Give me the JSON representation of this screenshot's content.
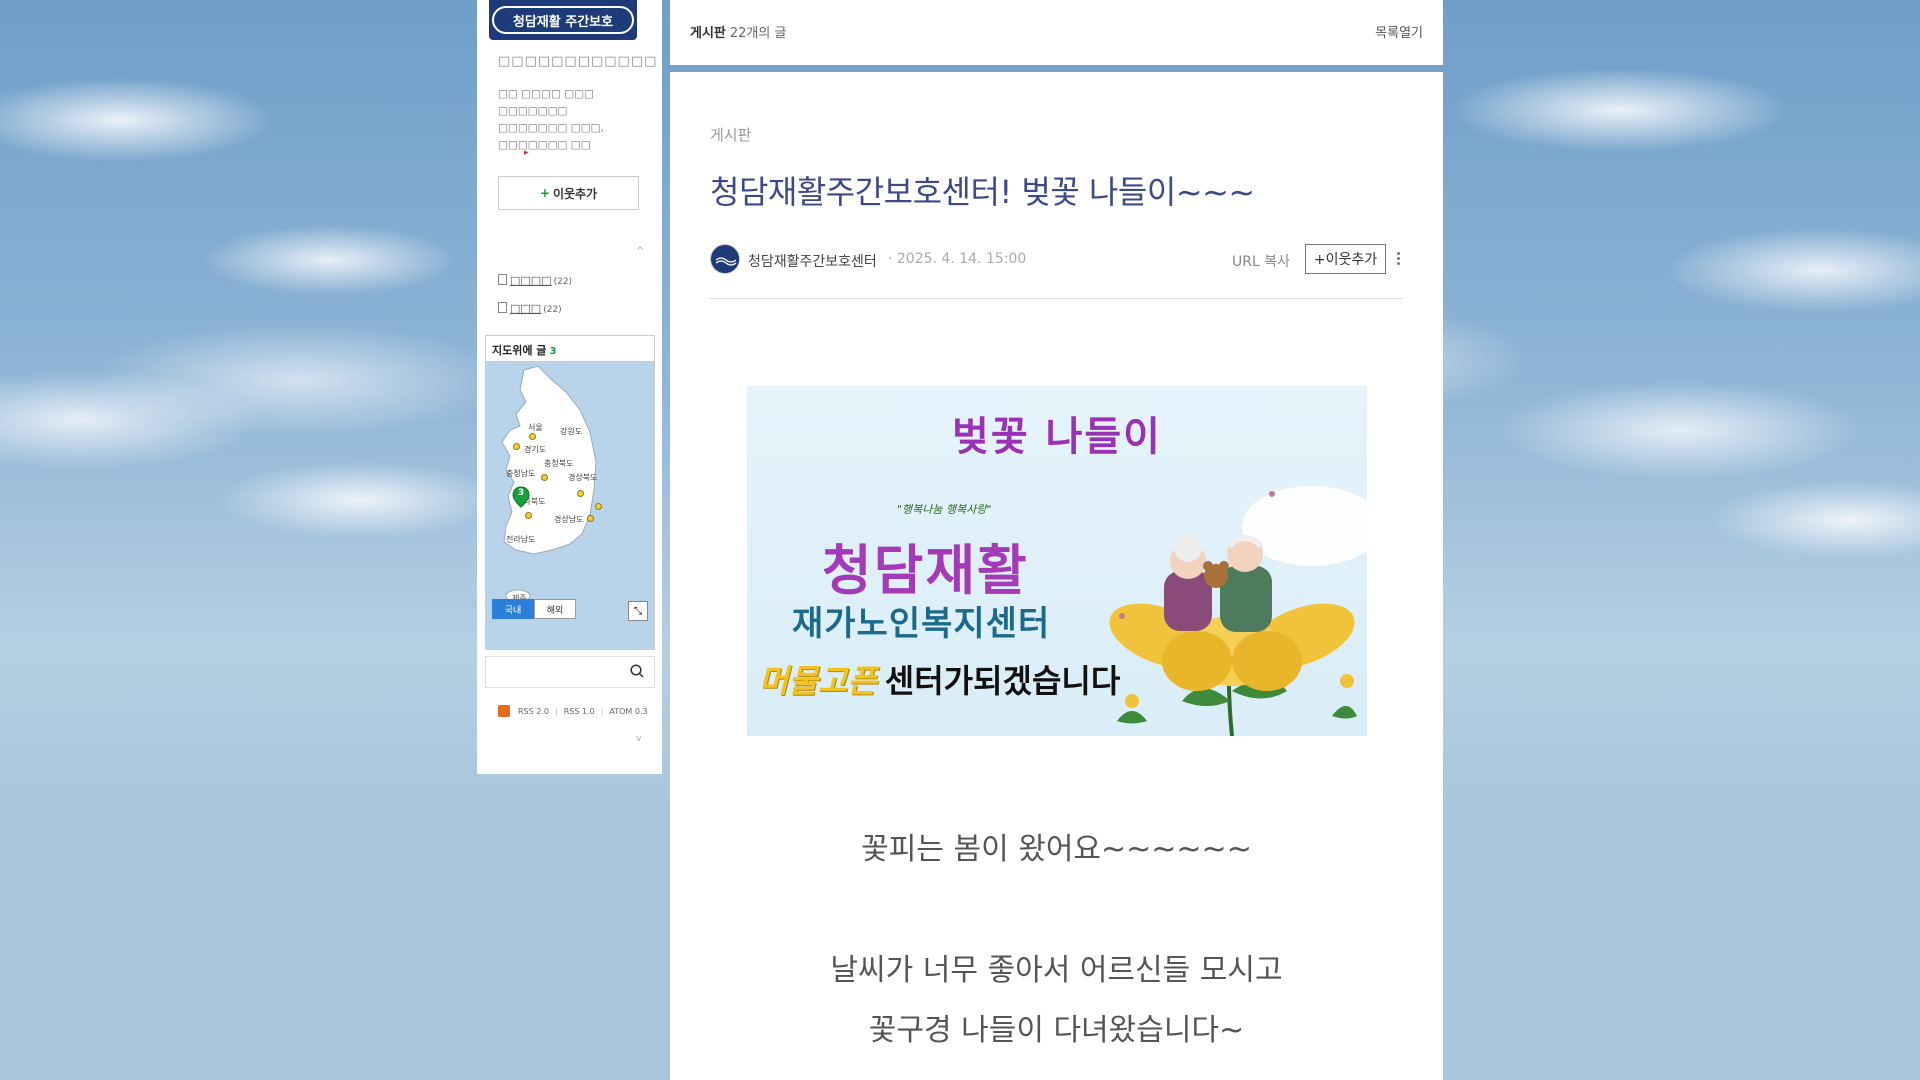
{
  "sidebar": {
    "logo_text": "청담재활 주간보호",
    "blog_title": "□□□□□□□□□□□□",
    "blog_desc": "□□ □□□□ □□□ □□□□□□□ □□□□□□□ □□□, □□□□□□□ □□",
    "add_neighbor_label": "이웃추가",
    "caret_up": "^",
    "categories": [
      {
        "label": "□□□□",
        "count": "(22)"
      },
      {
        "label": "□□□",
        "count": "(22)"
      }
    ],
    "map": {
      "title": "지도위에 글",
      "count": "3",
      "pin_count": "3",
      "labels": [
        "서울",
        "강원도",
        "경기도",
        "충청북도",
        "충청남도",
        "경상북도",
        "전라북도",
        "경상남도",
        "전라남도",
        "제주"
      ],
      "tabs": [
        "국내",
        "해외"
      ]
    },
    "rss": [
      "RSS 2.0",
      "RSS 1.0",
      "ATOM 0.3"
    ],
    "caret_down": "v"
  },
  "topbar": {
    "category": "게시판",
    "count": "22개의 글",
    "open_list": "목록열기"
  },
  "post": {
    "category": "게시판",
    "title": "청담재활주간보호센터! 벚꽃 나들이~~~",
    "author": "청담재활주간보호센터",
    "date": "· 2025. 4. 14. 15:00",
    "url_copy": "URL 복사",
    "add_neighbor": "+이웃추가",
    "banner": {
      "title": "벚꽃 나들이",
      "small": "\"행복나눔 행복사랑\"",
      "name": "청담재활",
      "sub": "재가노인복지센터",
      "highlight": "머물고픈",
      "tail": "센터가되겠습니다"
    },
    "paragraphs": [
      "꽃피는 봄이 왔어요~~~~~~",
      "날씨가 너무 좋아서 어르신들 모시고",
      "꽃구경 나들이 다녀왔습니다~"
    ]
  },
  "colors": {
    "title_blue": "#3d4a8a",
    "logo_navy": "#1c3b78",
    "accent_green": "#0a9f3a",
    "banner_purple": "#a33bb8"
  }
}
